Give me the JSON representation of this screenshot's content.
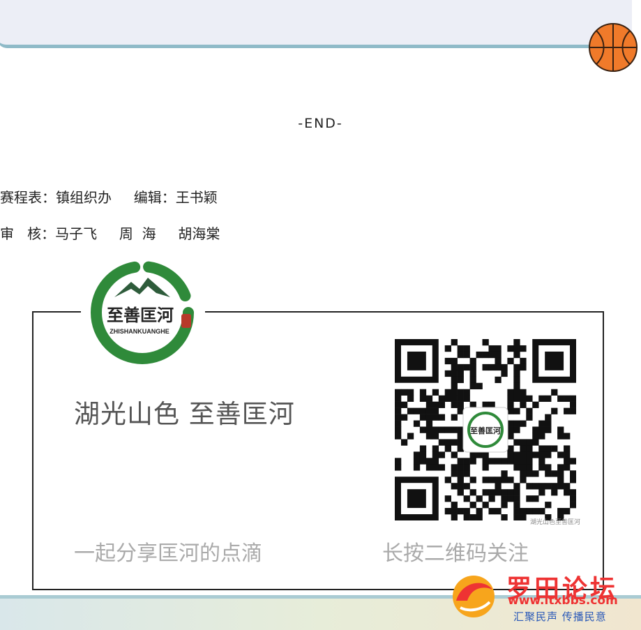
{
  "header": {
    "ball_icon": "basketball-icon"
  },
  "end_text": "-END-",
  "credits": {
    "line1": "赛程表：镇组织办     编辑：王书颖",
    "line2": "审   核：马子飞     周  海     胡海棠"
  },
  "card": {
    "logo_title": "至善匡河",
    "logo_pinyin": "ZHISHANKUANGHE",
    "slogan": "湖光山色 至善匡河",
    "subtitle_left": "一起分享匡河的点滴",
    "subtitle_right": "长按二维码关注",
    "qr_logo_title": "至善匡河",
    "qr_caption": "湖光山色至善匡河"
  },
  "watermark": {
    "title": "罗田论坛",
    "url": "www.ltxbbs.com",
    "motto": "汇聚民声  传播民意"
  },
  "colors": {
    "logo_green": "#2f8a3a",
    "mountain": "#2e5c3b",
    "watermark_red": "#e33333",
    "watermark_blue": "#2a59b8"
  }
}
